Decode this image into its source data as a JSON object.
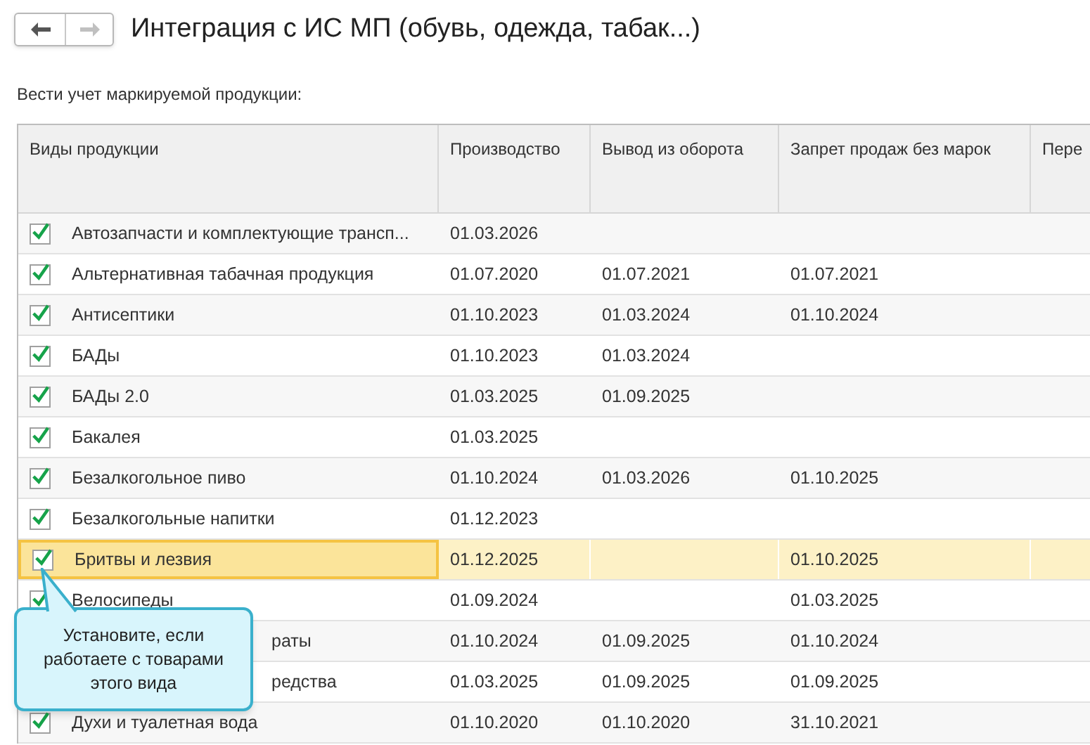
{
  "nav": {
    "back_disabled": false,
    "forward_disabled": true
  },
  "title": "Интеграция с ИС МП (обувь, одежда, табак...)",
  "section_label": "Вести учет маркируемой продукции:",
  "table": {
    "columns": [
      "Виды продукции",
      "Производство",
      "Вывод из оборота",
      "Запрет продаж без марок",
      "Пере"
    ],
    "rows": [
      {
        "checked": true,
        "selected": false,
        "kind": "plain",
        "cells": [
          "Автозапчасти и комплектующие трансп...",
          "01.03.2026",
          "",
          "",
          ""
        ]
      },
      {
        "checked": true,
        "selected": false,
        "kind": "plain",
        "cells": [
          "Альтернативная табачная продукция",
          "01.07.2020",
          "01.07.2021",
          "01.07.2021",
          ""
        ]
      },
      {
        "checked": true,
        "selected": false,
        "kind": "plain",
        "cells": [
          "Антисептики",
          "01.10.2023",
          "01.03.2024",
          "01.10.2024",
          ""
        ]
      },
      {
        "checked": true,
        "selected": false,
        "kind": "plain",
        "cells": [
          "БАДы",
          "01.10.2023",
          "01.03.2024",
          "",
          ""
        ]
      },
      {
        "checked": true,
        "selected": false,
        "kind": "plain",
        "cells": [
          "БАДы 2.0",
          "01.03.2025",
          "01.09.2025",
          "",
          ""
        ]
      },
      {
        "checked": true,
        "selected": false,
        "kind": "plain",
        "cells": [
          "Бакалея",
          "01.03.2025",
          "",
          "",
          ""
        ]
      },
      {
        "checked": true,
        "selected": false,
        "kind": "plain",
        "cells": [
          "Безалкогольное пиво",
          "01.10.2024",
          "01.03.2026",
          "01.10.2025",
          ""
        ]
      },
      {
        "checked": true,
        "selected": false,
        "kind": "plain",
        "cells": [
          "Безалкогольные напитки",
          "01.12.2023",
          "",
          "",
          ""
        ]
      },
      {
        "checked": true,
        "selected": true,
        "kind": "plain",
        "cells": [
          "Бритвы и лезвия",
          "01.12.2025",
          "",
          "01.10.2025",
          ""
        ]
      },
      {
        "checked": true,
        "selected": false,
        "kind": "plain",
        "cells": [
          "Велосипеды",
          "01.09.2024",
          "",
          "01.03.2025",
          ""
        ]
      },
      {
        "selected": false,
        "kind": "covered",
        "cells": [
          "раты",
          "01.10.2024",
          "01.09.2025",
          "01.10.2024",
          ""
        ]
      },
      {
        "selected": false,
        "kind": "covered",
        "cells": [
          "редства",
          "01.03.2025",
          "01.09.2025",
          "01.09.2025",
          ""
        ]
      },
      {
        "checked": true,
        "selected": false,
        "kind": "plain",
        "cells": [
          "Духи и туалетная вода",
          "01.10.2020",
          "01.10.2020",
          "31.10.2021",
          ""
        ]
      }
    ]
  },
  "callout": {
    "text": "Установите, если работаете с товарами этого вида"
  }
}
